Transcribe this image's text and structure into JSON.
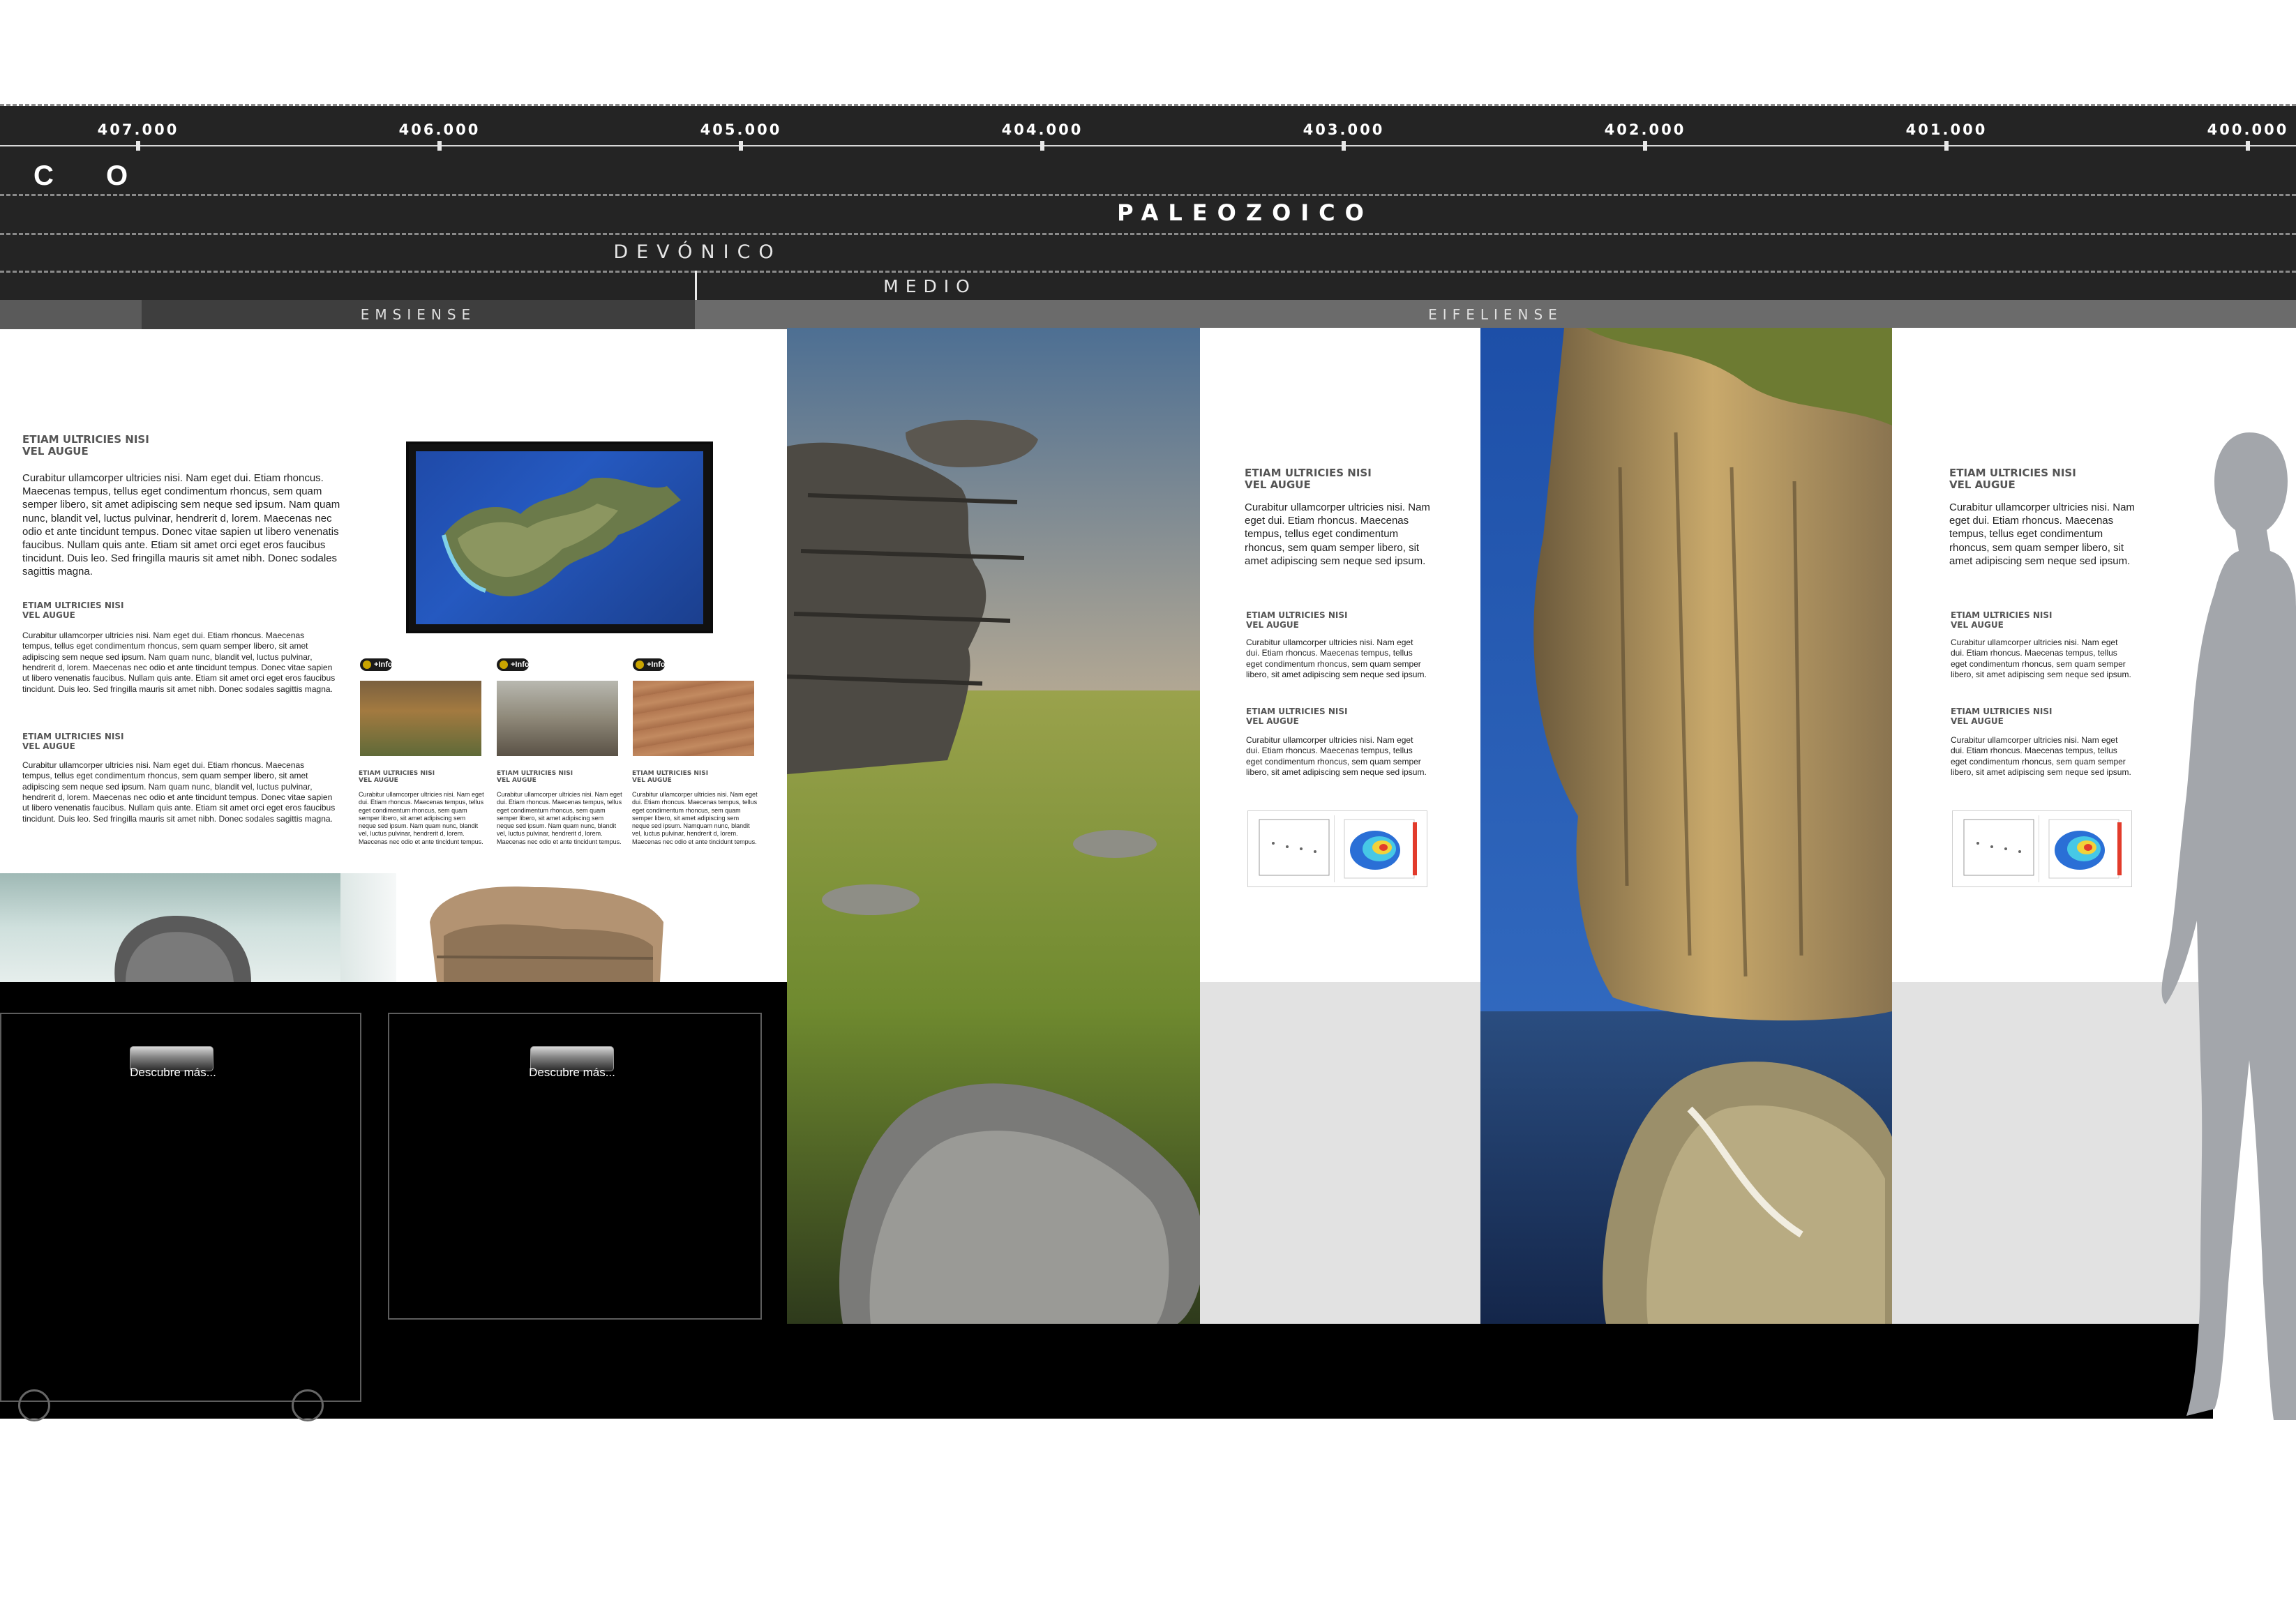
{
  "timeline": {
    "ticks": [
      "407.000",
      "406.000",
      "405.000",
      "404.000",
      "403.000",
      "402.000",
      "401.000",
      "400.000"
    ],
    "era": "C O",
    "period": "PALEOZOICO",
    "epoch": "DEVÓNICO",
    "sub_epoch": "MEDIO",
    "stages": [
      "",
      "EMSIENSE",
      "EIFELIENSE"
    ]
  },
  "panel1": {
    "heading1": "ETIAM ULTRICIES NISI\nVEL AUGUE",
    "body1": "Curabitur ullamcorper ultricies nisi. Nam eget dui. Etiam rhoncus. Maecenas tempus, tellus eget condimentum rhoncus, sem quam semper libero, sit amet adipiscing sem neque sed ipsum. Nam quam nunc, blandit vel, luctus pulvinar, hendrerit d, lorem. Maecenas nec odio et ante tincidunt tempus. Donec vitae sapien ut libero venenatis faucibus. Nullam quis ante. Etiam sit amet orci eget eros faucibus tincidunt. Duis leo. Sed fringilla mauris sit amet nibh. Donec sodales sagittis magna.",
    "heading2": "ETIAM ULTRICIES NISI\nVEL AUGUE",
    "body2": "Curabitur ullamcorper ultricies nisi. Nam eget dui. Etiam rhoncus. Maecenas tempus, tellus eget condimentum rhoncus, sem quam semper libero, sit amet adipiscing sem neque sed ipsum. Nam quam nunc, blandit vel, luctus pulvinar, hendrerit d, lorem. Maecenas nec odio et ante tincidunt tempus. Donec vitae sapien ut libero venenatis faucibus. Nullam quis ante. Etiam sit amet orci eget eros faucibus tincidunt. Duis leo. Sed fringilla mauris sit amet nibh. Donec sodales sagittis magna.",
    "heading3": "ETIAM ULTRICIES NISI\nVEL AUGUE",
    "body3": "Curabitur ullamcorper ultricies nisi. Nam eget dui. Etiam rhoncus. Maecenas tempus, tellus eget condimentum rhoncus, sem quam semper libero, sit amet adipiscing sem neque sed ipsum. Nam quam nunc, blandit vel, luctus pulvinar, hendrerit d, lorem. Maecenas nec odio et ante tincidunt tempus. Donec vitae sapien ut libero venenatis faucibus. Nullam quis ante. Etiam sit amet orci eget eros faucibus tincidunt. Duis leo. Sed fringilla mauris sit amet nibh. Donec sodales sagittis magna.",
    "info_badge": "+Info",
    "thumbs": [
      {
        "heading": "ETIAM ULTRICIES NISI\nVEL AUGUE",
        "body": "Curabitur ullamcorper ultricies nisi. Nam eget dui. Etiam rhoncus. Maecenas tempus, tellus eget condimentum rhoncus, sem quam semper libero, sit amet adipiscing sem neque sed ipsum. Nam quam nunc, blandit vel, luctus pulvinar, hendrerit d, lorem. Maecenas nec odio et ante tincidunt tempus."
      },
      {
        "heading": "ETIAM ULTRICIES NISI\nVEL AUGUE",
        "body": "Curabitur ullamcorper ultricies nisi. Nam eget dui. Etiam rhoncus. Maecenas tempus, tellus eget condimentum rhoncus, sem quam semper libero, sit amet adipiscing sem neque sed ipsum. Nam quam nunc, blandit vel, luctus pulvinar, hendrerit d, lorem. Maecenas nec odio et ante tincidunt tempus."
      },
      {
        "heading": "ETIAM ULTRICIES NISI\nVEL AUGUE",
        "body": "Curabitur ullamcorper ultricies nisi. Nam eget dui. Etiam rhoncus. Maecenas tempus, tellus eget condimentum rhoncus, sem quam semper libero, sit amet adipiscing sem neque sed ipsum. Namquam nunc, blandit vel, luctus pulvinar, hendrerit d, lorem. Maecenas nec odio et ante tincidunt tempus."
      }
    ],
    "discover_label": "Descubre más..."
  },
  "panel2": {
    "heading1": "ETIAM ULTRICIES NISI\nVEL AUGUE",
    "body1": "Curabitur ullamcorper ultricies nisi. Nam eget dui. Etiam rhoncus. Maecenas tempus, tellus eget condimentum rhoncus, sem quam semper libero, sit amet adipiscing sem neque sed ipsum.",
    "heading2": "ETIAM ULTRICIES NISI\nVEL AUGUE",
    "body2": "Curabitur ullamcorper ultricies nisi. Nam eget dui. Etiam rhoncus. Maecenas tempus, tellus eget condimentum rhoncus, sem quam semper libero, sit amet adipiscing sem neque sed ipsum.",
    "heading3": "ETIAM ULTRICIES NISI\nVEL AUGUE",
    "body3": "Curabitur ullamcorper ultricies nisi. Nam eget dui. Etiam rhoncus. Maecenas tempus, tellus eget condimentum rhoncus, sem quam semper libero, sit amet adipiscing sem neque sed ipsum."
  },
  "panel3": {
    "heading1": "ETIAM ULTRICIES NISI\nVEL AUGUE",
    "body1": "Curabitur ullamcorper ultricies nisi. Nam eget dui. Etiam rhoncus. Maecenas tempus, tellus eget condimentum rhoncus, sem quam semper libero, sit amet adipiscing sem neque sed ipsum.",
    "heading2": "ETIAM ULTRICIES NISI\nVEL AUGUE",
    "body2": "Curabitur ullamcorper ultricies nisi. Nam eget dui. Etiam rhoncus. Maecenas tempus, tellus eget condimentum rhoncus, sem quam semper libero, sit amet adipiscing sem neque sed ipsum.",
    "heading3": "ETIAM ULTRICIES NISI\nVEL AUGUE",
    "body3": "Curabitur ullamcorper ultricies nisi. Nam eget dui. Etiam rhoncus. Maecenas tempus, tellus eget condimentum rhoncus, sem quam semper libero, sit amet adipiscing sem neque sed ipsum."
  },
  "colors": {
    "timeline_bg": "#242424",
    "stage_emsiense": "#3e3e3e",
    "stage_eifeliense": "#6b6b6b",
    "floor_grey": "#e2e2e2",
    "human_silhouette": "#a3a6ab"
  },
  "icons": [
    "info-icon",
    "wheel-icon",
    "human-silhouette-icon"
  ]
}
